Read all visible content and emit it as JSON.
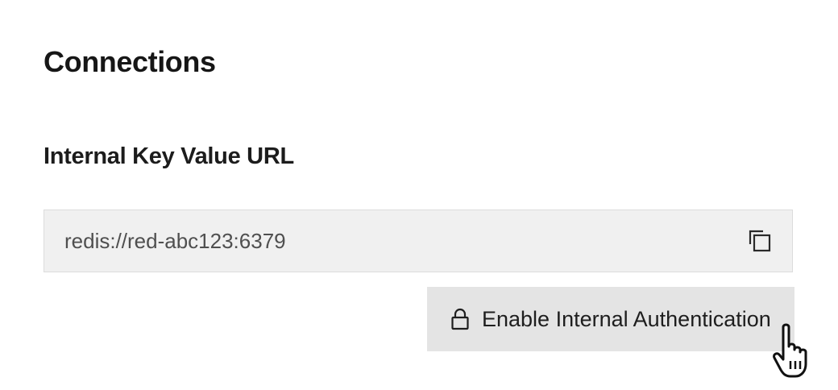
{
  "connections": {
    "title": "Connections",
    "internal_url": {
      "label": "Internal Key Value URL",
      "value": "redis://red-abc123:6379",
      "copy_icon": "copy-icon"
    },
    "auth_button": {
      "icon": "lock-icon",
      "label": "Enable Internal Authentication"
    }
  },
  "pointer": {
    "icon": "hand-pointer-cursor-icon"
  },
  "colors": {
    "field_background": "#f0f0f0",
    "button_background": "#e4e4e4",
    "text_primary": "#161616",
    "text_muted": "#4f4f4f"
  }
}
